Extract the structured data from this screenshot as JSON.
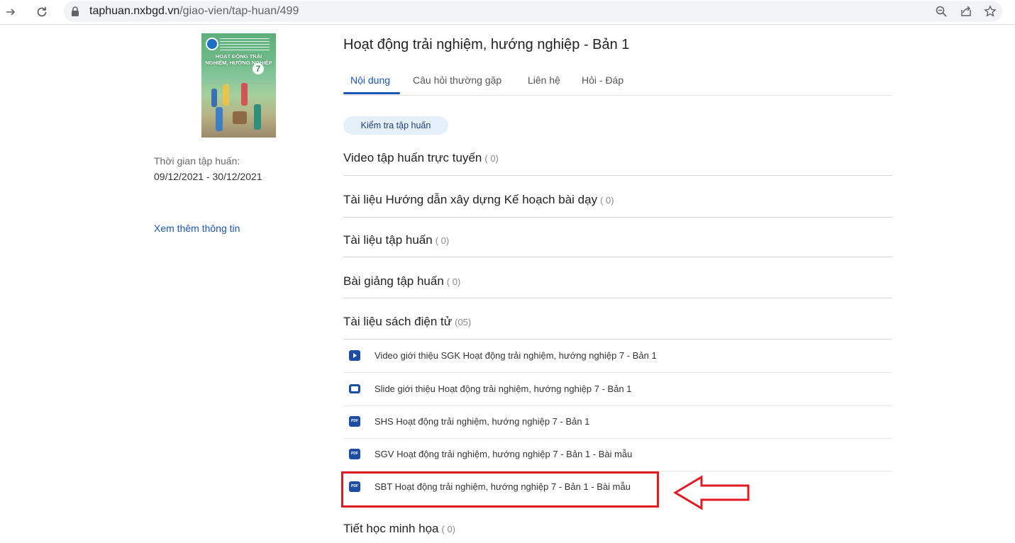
{
  "browser": {
    "url_domain": "taphuan.nxbgd.vn",
    "url_path": "/giao-vien/tap-huan/499"
  },
  "sidebar": {
    "cover": {
      "title": "HOẠT ĐỘNG TRẢI NGHIỆM, HƯỚNG NGHIỆP",
      "grade": "7"
    },
    "time_label": "Thời gian tập huấn:",
    "time_value": "09/12/2021 - 30/12/2021",
    "more_link": "Xem thêm thông tin"
  },
  "main": {
    "title": "Hoạt động trải nghiệm, hướng nghiệp - Bản 1",
    "tabs": [
      {
        "label": "Nội dung",
        "active": true
      },
      {
        "label": "Câu hỏi thường gặp",
        "active": false
      },
      {
        "label": "Liên hệ",
        "active": false
      },
      {
        "label": "Hỏi - Đáp",
        "active": false
      }
    ],
    "check_button": "Kiểm tra tập huấn",
    "sections": [
      {
        "title": "Video tập huấn trực tuyến",
        "count": "( 0)"
      },
      {
        "title": "Tài liệu Hướng dẫn xây dựng Kế hoạch bài dạy",
        "count": "( 0)"
      },
      {
        "title": "Tài liệu tập huấn",
        "count": "( 0)"
      },
      {
        "title": "Bài giảng tập huấn",
        "count": "( 0)"
      },
      {
        "title": "Tài liệu sách điện tử",
        "count": "(05)"
      },
      {
        "title": "Tiết học minh họa",
        "count": "( 0)"
      }
    ],
    "files": [
      {
        "icon": "video-play-icon",
        "label": "Video giới thiệu SGK Hoạt động trải nghiệm, hướng nghiệp 7 - Bản 1"
      },
      {
        "icon": "slide-icon",
        "label": "Slide giới thiệu Hoạt động trải nghiệm, hướng nghiệp 7 - Bản 1"
      },
      {
        "icon": "pdf-icon",
        "label": "SHS Hoạt động trải nghiệm, hướng nghiệp 7 - Bản 1"
      },
      {
        "icon": "pdf-icon",
        "label": "SGV Hoạt động trải nghiệm, hướng nghiệp 7 - Bản 1 - Bài mẫu"
      },
      {
        "icon": "pdf-icon",
        "label": "SBT Hoạt động trải nghiệm, hướng nghiệp 7 - Bản 1 - Bài mẫu"
      }
    ],
    "pdf_icon_text": "PDF"
  },
  "colors": {
    "accent": "#1a56b4",
    "annotation": "#e21b23"
  }
}
